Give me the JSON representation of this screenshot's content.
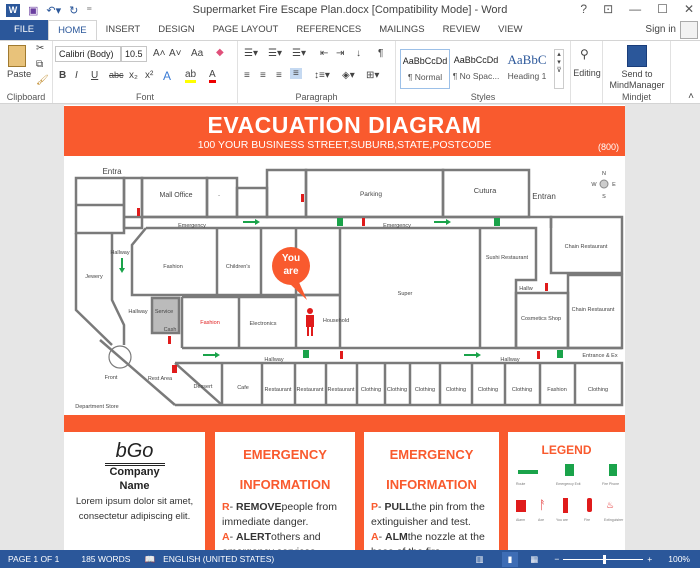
{
  "window": {
    "title": "Supermarket Fire Escape Plan.docx [Compatibility Mode] - Word",
    "help": "?",
    "minimize": "—",
    "maximize": "☐",
    "close": "✕"
  },
  "tabs": [
    "FILE",
    "HOME",
    "INSERT",
    "DESIGN",
    "PAGE LAYOUT",
    "REFERENCES",
    "MAILINGS",
    "REVIEW",
    "VIEW"
  ],
  "signin": "Sign in",
  "ribbon": {
    "clipboard": {
      "label": "Clipboard",
      "paste": "Paste"
    },
    "font": {
      "label": "Font",
      "name": "Calibri (Body)",
      "size": "10.5",
      "bold": "B",
      "italic": "I",
      "underline": "U",
      "strike": "abc",
      "sub": "x₂",
      "sup": "x²",
      "grow": "A˄",
      "shrink": "A˅",
      "case": "Aa"
    },
    "paragraph": {
      "label": "Paragraph",
      "pilcrow": "¶"
    },
    "styles": {
      "label": "Styles",
      "items": [
        {
          "preview": "AaBbCcDd",
          "name": "¶ Normal"
        },
        {
          "preview": "AaBbCcDd",
          "name": "¶ No Spac..."
        },
        {
          "preview": "AaBbC",
          "name": "Heading 1"
        }
      ]
    },
    "editing": {
      "label": "Editing"
    },
    "mindjet": {
      "label": "Mindjet",
      "button": "Send to MindManager"
    }
  },
  "document": {
    "title": "EVACUATION DIAGRAM",
    "address": "100 YOUR BUSINESS STREET,SUBURB,STATE,POSTCODE",
    "phone": "(800)",
    "map": {
      "rooms": [
        "Entra",
        "Mall Office",
        "-",
        "Parking",
        "Cutura",
        "Entran",
        "Emergency",
        "Emergency",
        "Hallway",
        "Jewery",
        "Fashion",
        "Children's",
        "Super",
        "Sushi Restaurant",
        "Chain Restaurant",
        "Hallw",
        "Chain Restaurant",
        "Cosmetics Shop",
        "Hallway",
        "Service",
        "Cash",
        "Fashion",
        "Electronics",
        "Household",
        "Hallway",
        "Hallway",
        "Front",
        "Rest Area",
        "Dessert",
        "Cafe",
        "Restaurant",
        "Restaurant",
        "Restaurant",
        "Clothing",
        "Clothing",
        "Clothing",
        "Clothing",
        "Clothing",
        "Clothing",
        "Clothing",
        "Fashion",
        "Clothing",
        "Entrance & Ex",
        "Department Store"
      ],
      "you_are": [
        "You",
        "are"
      ],
      "compass": [
        "N",
        "S",
        "W",
        "E"
      ]
    },
    "company": {
      "logo": "bGo",
      "name1": "Company",
      "name2": "Name",
      "text": "Lorem ipsum dolor sit amet, consectetur adipiscing elit."
    },
    "info1": {
      "h1": "EMERGENCY",
      "h2": "INFORMATION",
      "l1": "R",
      "b1": "REMOVE",
      "t1": "people from immediate danger.",
      "l2": "A",
      "b2": "ALERT",
      "t2": "others and emergency services."
    },
    "info2": {
      "h1": "EMERGENCY",
      "h2": "INFORMATION",
      "l1": "P",
      "b1": "PULL",
      "t1": "the pin from the extinguisher and test.",
      "l2": "A",
      "b2": "ALM",
      "t2": "the nozzle at the base of the fire."
    },
    "legend": {
      "title": "LEGEND",
      "items": [
        "Route",
        "Emergency Exit",
        "Fire Phone",
        "Alarm",
        "Axe",
        "You are",
        "Fire",
        "Extinguisher"
      ]
    }
  },
  "status": {
    "page": "PAGE 1 OF 1",
    "words": "185 WORDS",
    "language": "ENGLISH (UNITED STATES)",
    "zoom": "100%",
    "zoom_percent": 100
  },
  "colors": {
    "accent": "#f95a2e",
    "word": "#2b579a",
    "exit": "#1aa34a"
  }
}
